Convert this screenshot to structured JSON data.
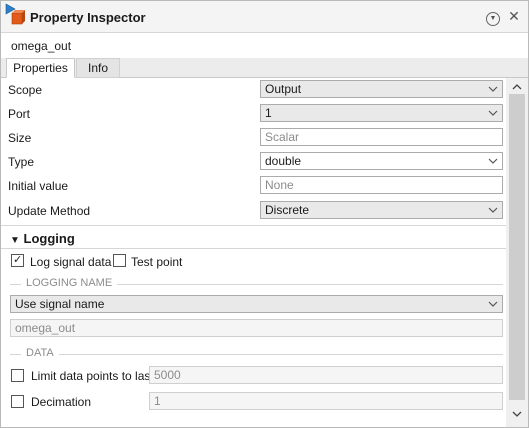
{
  "window": {
    "title": "Property Inspector",
    "object_name": "omega_out"
  },
  "icons": {
    "app": "simulink-block-icon",
    "menu": "options-menu-icon",
    "close": "close-icon"
  },
  "tabs": [
    {
      "label": "Properties",
      "active": true
    },
    {
      "label": "Info",
      "active": false
    }
  ],
  "properties": {
    "scope": {
      "label": "Scope",
      "value": "Output"
    },
    "port": {
      "label": "Port",
      "value": "1"
    },
    "size": {
      "label": "Size",
      "placeholder": "Scalar"
    },
    "type": {
      "label": "Type",
      "value": "double"
    },
    "initial_value": {
      "label": "Initial value",
      "placeholder": "None"
    },
    "update_method": {
      "label": "Update Method",
      "value": "Discrete"
    }
  },
  "logging": {
    "title": "Logging",
    "log_signal_data": {
      "label": "Log signal data",
      "checked": true
    },
    "test_point": {
      "label": "Test point",
      "checked": false
    },
    "logging_name_group": "LOGGING NAME",
    "logging_name_mode": "Use signal name",
    "logging_name_value": "omega_out",
    "data_group": "DATA",
    "limit_points": {
      "label": "Limit data points to last",
      "checked": false,
      "value": "5000"
    },
    "decimation": {
      "label": "Decimation",
      "checked": false,
      "value": "1"
    }
  }
}
